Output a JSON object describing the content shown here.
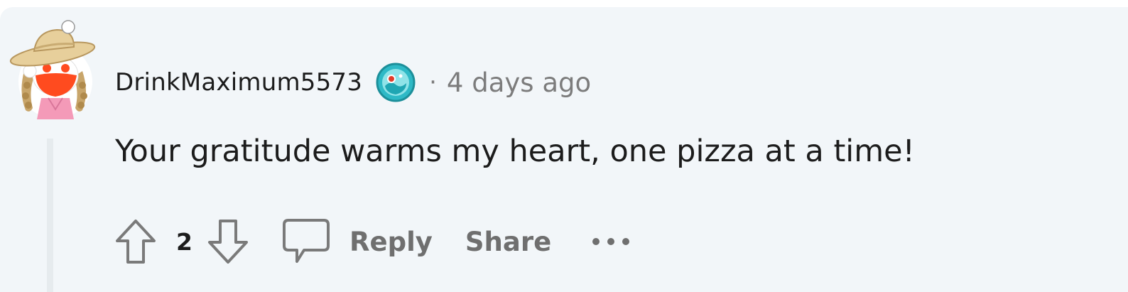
{
  "comment": {
    "username": "DrinkMaximum5573",
    "separator": "·",
    "timestamp": "4 days ago",
    "body": "Your gratitude warms my heart, one pizza at a time!",
    "score": "2"
  },
  "actions": {
    "upvote_icon": "arrow-up-outline-icon",
    "downvote_icon": "arrow-down-outline-icon",
    "reply_icon": "speech-bubble-icon",
    "reply_label": "Reply",
    "share_label": "Share",
    "more_icon": "ellipsis-icon"
  },
  "colors": {
    "card_background": "#f2f6f9",
    "text_primary": "#1c1c1c",
    "text_muted": "#7c7c7c",
    "action_gray": "#6f6f6f",
    "thread_line": "#e6ebee"
  }
}
